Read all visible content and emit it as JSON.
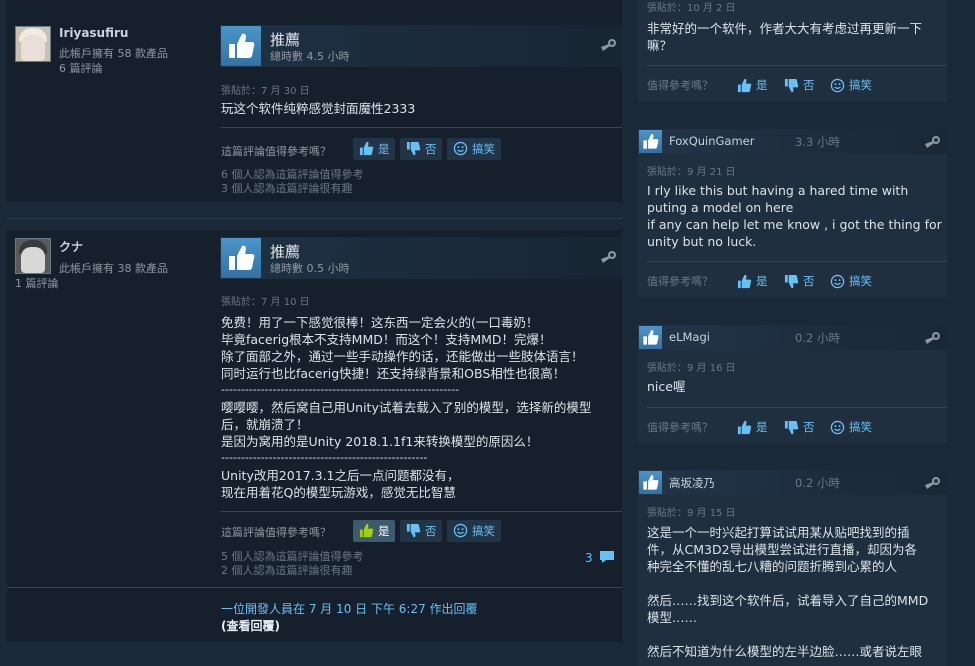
{
  "reviews": [
    {
      "author": {
        "name": "Iriyasufiru",
        "products": "此帳戶擁有 58 款產品",
        "reviews": "6 篇評論"
      },
      "recommendation": "推薦",
      "hours": "總時數 4.5 小時",
      "posted": "張貼於：7 月 30 日",
      "body": [
        "玩这个软件纯粹感觉封面魔性2333"
      ],
      "vote_question": "這篇評論值得參考嗎？",
      "buttons": {
        "yes": "是",
        "no": "否",
        "funny": "搞笑"
      },
      "helpful": [
        "6 個人認為這篇評論值得參考",
        "3 個人認為這篇評論很有趣"
      ]
    },
    {
      "author": {
        "name": "クナ",
        "products": "此帳戶擁有 38 款產品",
        "reviews": "1 篇評論"
      },
      "recommendation": "推薦",
      "hours": "總時數 0.5 小時",
      "posted": "張貼於：7 月 10 日",
      "body": [
        "免费！用了一下感觉很棒！这东西一定会火的(一口毒奶！",
        "毕竟facerig根本不支持MMD！而这个！支持MMD！完爆！",
        "除了面部之外，通过一些手动操作的话，还能做出一些肢体语言！",
        "同时运行也比facerig快捷！还支持绿背景和OBS相性也很高！",
        "------------------------------------------------------------",
        "嘤嘤嘤，然后窝自己用Unity试着去载入了别的模型，选择新的模型",
        "后，就崩溃了！",
        "是因为窝用的是Unity 2018.1.1f1来转换模型的原因么！",
        "----------------------------------------------------",
        "Unity改用2017.3.1之后一点问题都没有，",
        "现在用着花Q的模型玩游戏，感觉无比智慧"
      ],
      "vote_question": "這篇評論值得參考嗎？",
      "buttons": {
        "yes": "是",
        "no": "否",
        "funny": "搞笑"
      },
      "helpful": [
        "5 個人認為這篇評論值得參考",
        "2 個人認為這篇評論很有趣"
      ],
      "comment_count": "3",
      "dev_reply": "一位開發人員在 7 月 10 日 下午 6:27 作出回覆",
      "view_reply": "(查看回覆)"
    }
  ],
  "side_reviews": [
    {
      "posted": "張貼於：10 月 2 日",
      "body": [
        "非常好的一个软件，作者大大有考虑过再更新一下",
        "嘛？"
      ],
      "vote_question": "值得參考嗎？",
      "buttons": {
        "yes": "是",
        "no": "否",
        "funny": "搞笑"
      }
    },
    {
      "name": "FoxQuinGamer",
      "hours": "3.3 小時",
      "posted": "張貼於：9 月 21 日",
      "body": [
        "I rly like this but having a hared time with",
        "puting a model on here",
        "if any can help let me know , i got the thing for",
        "unity but no luck."
      ],
      "vote_question": "值得參考嗎？",
      "buttons": {
        "yes": "是",
        "no": "否",
        "funny": "搞笑"
      }
    },
    {
      "name": "eLMagi",
      "hours": "0.2 小時",
      "posted": "張貼於：9 月 16 日",
      "body": [
        "nice喔"
      ],
      "vote_question": "值得參考嗎？",
      "buttons": {
        "yes": "是",
        "no": "否",
        "funny": "搞笑"
      }
    },
    {
      "name": "高坂凌乃",
      "hours": "0.2 小時",
      "posted": "張貼於：9 月 15 日",
      "body": [
        "这是一个一时兴起打算试试用某从贴吧找到的插",
        "件，从CM3D2导出模型尝试进行直播，却因为各",
        "种完全不懂的乱七八糟的问题折腾到心累的人",
        "",
        "然后……找到这个软件后，试着导入了自己的MMD",
        "模型……",
        "",
        "然后不知道为什么模型的左半边脸……或者说左眼"
      ]
    }
  ],
  "colors": {
    "background": "#1b2838",
    "link": "#67c1f5",
    "thumb": "#4b95c8"
  },
  "icons": [
    "thumbs-up-icon",
    "thumbs-down-icon",
    "smiley-icon",
    "steam-badge-icon",
    "comment-icon"
  ]
}
